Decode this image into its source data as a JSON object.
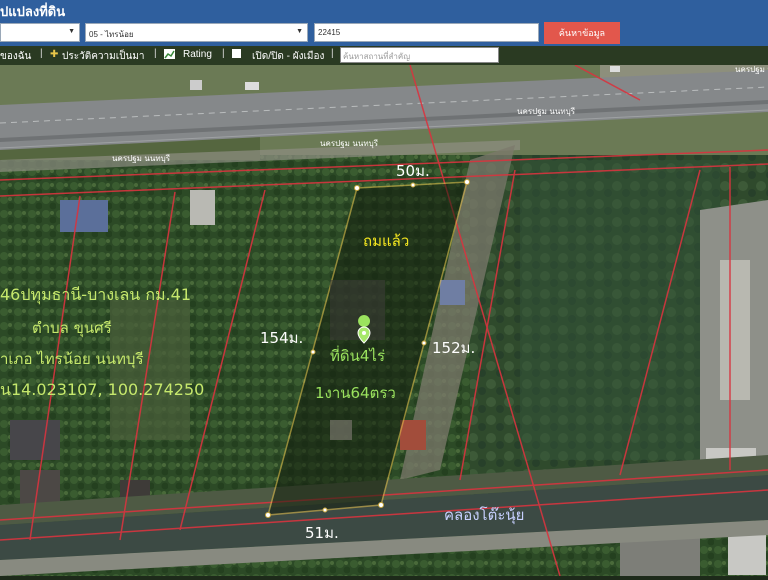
{
  "app": {
    "title": "ูปแปลงที่ดิน"
  },
  "search": {
    "district_value": "05 - ไทรน้อย",
    "parcel_value": "22415",
    "button_label": "ค้นหาข้อมูล"
  },
  "toolbar": {
    "item1": "ของฉัน",
    "item2": "ประวัติความเป็นมา",
    "item3": "Rating",
    "item4": "เปิด/ปิด - ผังเมือง",
    "place_placeholder": "ค้นหาสถานที่สำคัญ"
  },
  "map": {
    "road_labels": [
      "นครปฐม นนทบุรี",
      "นครปฐม นนทบุรี",
      "นครปฐม นนทบุรี",
      "นครปฐม นนทบุรี"
    ],
    "top_width": "50ม.",
    "bottom_width": "51ม.",
    "left_length": "154ม.",
    "right_length": "152ม.",
    "paved_label": "ถมแล้ว",
    "area_line1": "ที่ดิน4ไร่",
    "area_line2": "1งาน64ตรว",
    "canal_label": "คลองโต๊ะนุ้ย",
    "address": {
      "line1": "46ปทุมธานี-บางเลน กม.41",
      "line2": "ตำบล ขุนศรี",
      "line3": "ำเภอ ไทรน้อย นนทบุรี",
      "line4": "น14.023107, 100.274250"
    }
  },
  "colors": {
    "header_bg": "#2f5f9e",
    "button_red": "#e2574c",
    "parcel_outline": "#e8c04a",
    "label_yellow": "#f3e51f",
    "label_green": "#9be35e",
    "boundary_red": "#d8343f"
  }
}
